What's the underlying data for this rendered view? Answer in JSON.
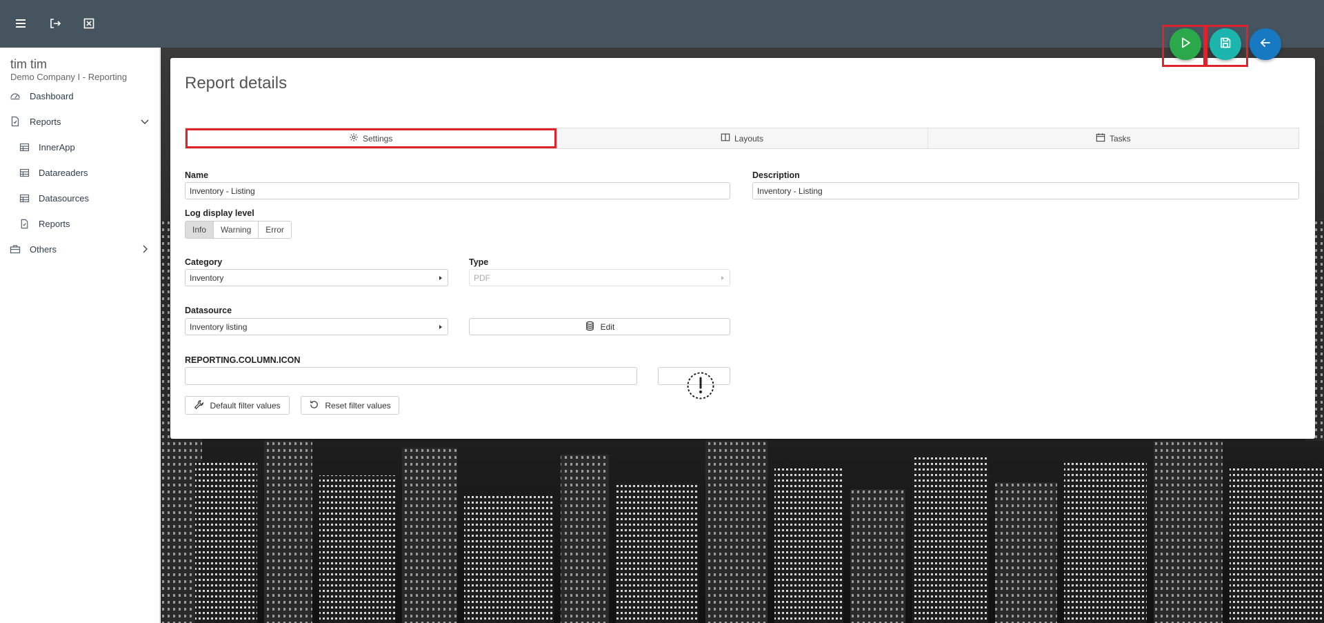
{
  "colors": {
    "topbar": "#46545f",
    "run_fab": "#2aa84a",
    "save_fab": "#1bb5ad",
    "back_fab": "#1679c2",
    "highlight": "#e0232b"
  },
  "topbar": {
    "icons": [
      "menu-icon",
      "logout-icon",
      "close-box-icon"
    ]
  },
  "sidebar": {
    "user_name": "tim tim",
    "company": "Demo Company I - Reporting",
    "items": [
      {
        "label": "Dashboard",
        "icon": "dashboard-icon"
      },
      {
        "label": "Reports",
        "icon": "report-file-icon",
        "expanded": true
      },
      {
        "label": "InnerApp",
        "icon": "table-icon"
      },
      {
        "label": "Datareaders",
        "icon": "table-icon"
      },
      {
        "label": "Datasources",
        "icon": "table-icon"
      },
      {
        "label": "Reports",
        "icon": "report-file-icon"
      },
      {
        "label": "Others",
        "icon": "toolbox-icon",
        "expanded": false
      }
    ]
  },
  "card": {
    "title": "Report details",
    "tabs": [
      {
        "label": "Settings",
        "icon": "gear-icon",
        "active": true
      },
      {
        "label": "Layouts",
        "icon": "columns-icon"
      },
      {
        "label": "Tasks",
        "icon": "calendar-icon"
      }
    ],
    "name": {
      "label": "Name",
      "value": "Inventory - Listing"
    },
    "description": {
      "label": "Description",
      "value": "Inventory - Listing"
    },
    "log_level": {
      "label": "Log display level",
      "options": [
        "Info",
        "Warning",
        "Error"
      ],
      "selected": "Info"
    },
    "category": {
      "label": "Category",
      "value": "Inventory"
    },
    "type": {
      "label": "Type",
      "value": "PDF"
    },
    "datasource": {
      "label": "Datasource",
      "value": "Inventory listing"
    },
    "edit_button": "Edit",
    "column_icon": {
      "label": "REPORTING.COLUMN.ICON",
      "value": ""
    },
    "default_filter_button": "Default filter values",
    "reset_filter_button": "Reset filter values"
  },
  "actions": [
    "run-icon",
    "save-icon",
    "back-arrow-icon"
  ]
}
